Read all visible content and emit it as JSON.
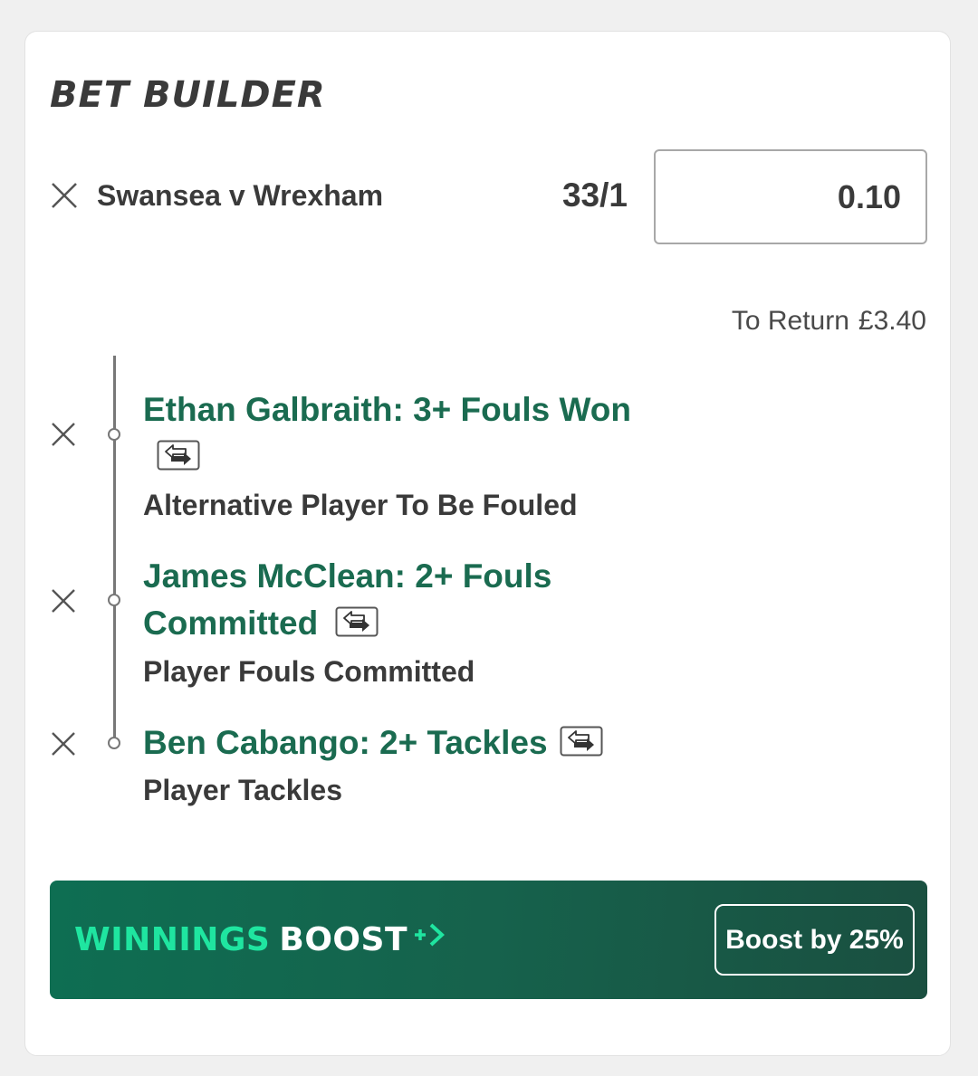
{
  "bet_builder": {
    "title": "BET BUILDER",
    "event": "Swansea v Wrexham",
    "odds": "33/1",
    "stake_value": "0.10",
    "to_return_label": "To Return",
    "to_return_amount": "£3.40",
    "selections": [
      {
        "title": "Ethan Galbraith: 3+ Fouls Won",
        "market": "Alternative Player To Be Fouled"
      },
      {
        "title_line1": "James McClean: 2+ Fouls",
        "title_line2": "Committed",
        "market": "Player Fouls Committed"
      },
      {
        "title": "Ben Cabango: 2+ Tackles",
        "market": "Player Tackles"
      }
    ]
  },
  "boost": {
    "logo_part1": "WINNINGS",
    "logo_part2": "BOOST",
    "button_label": "Boost by 25%"
  },
  "colors": {
    "selection_green": "#1a6b50",
    "boost_banner": "#16624c",
    "boost_accent": "#1fe5a0"
  },
  "icons": {
    "remove": "close-icon",
    "swap": "swap-arrows-icon",
    "boost_arrow": "boost-arrow-icon"
  }
}
